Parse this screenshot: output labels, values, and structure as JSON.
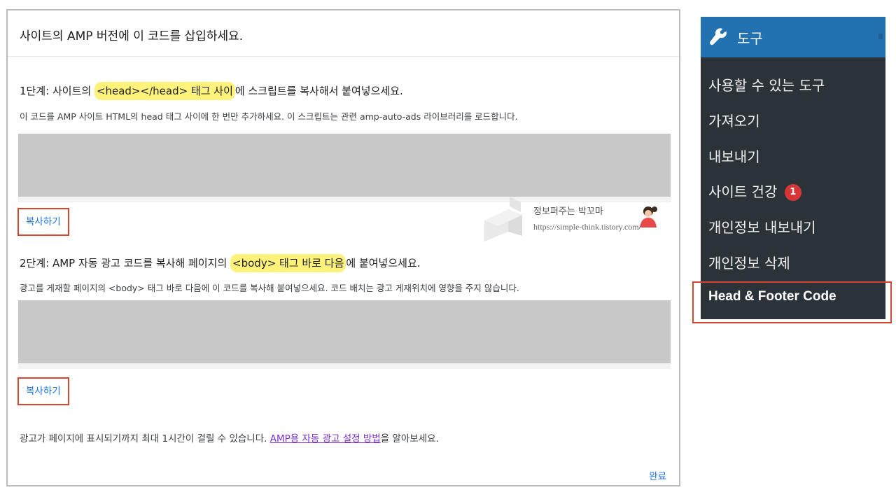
{
  "dialog": {
    "title": "사이트의 AMP 버전에 이 코드를 삽입하세요.",
    "step1": {
      "title_prefix": "1단계: 사이트의 ",
      "title_highlight": "<head></head> 태그 사이",
      "title_suffix": "에 스크립트를 복사해서 붙여넣으세요.",
      "description": "이 코드를 AMP 사이트 HTML의 head 태그 사이에 한 번만 추가하세요. 이 스크립트는 관련 amp-auto-ads 라이브러리를 로드합니다.",
      "copy_label": "복사하기"
    },
    "step2": {
      "title_prefix": "2단계: AMP 자동 광고 코드를 복사해 페이지의 ",
      "title_highlight": "<body> 태그 바로 다음",
      "title_suffix": "에 붙여넣으세요.",
      "description": "광고를 게재할 페이지의 <body> 태그 바로 다음에 이 코드를 복사해 붙여넣으세요. 코드 배치는 광고 게재위치에 영향을 주지 않습니다.",
      "copy_label": "복사하기"
    },
    "footnote_prefix": "광고가 페이지에 표시되기까지 최대 1시간이 걸릴 수 있습니다. ",
    "footnote_link": "AMP용 자동 광고 설정 방법",
    "footnote_suffix": "을 알아보세요.",
    "done_label": "완료"
  },
  "watermark": {
    "line1": "정보퍼주는 박꼬마",
    "line2": "https://simple-think.tistory.com/"
  },
  "wp_menu": {
    "header": "도구",
    "header_icon": "wrench-icon",
    "items": [
      {
        "label": "사용할 수 있는 도구"
      },
      {
        "label": "가져오기"
      },
      {
        "label": "내보내기"
      },
      {
        "label": "사이트 건강",
        "badge": "1"
      },
      {
        "label": "개인정보 내보내기"
      },
      {
        "label": "개인정보 삭제"
      }
    ],
    "current": "Head & Footer Code"
  },
  "colors": {
    "highlight": "#fff27a",
    "callout_border": "#d6452f",
    "link": "#1a73e8",
    "wp_blue": "#2271b1",
    "wp_dark": "#2c3338"
  }
}
